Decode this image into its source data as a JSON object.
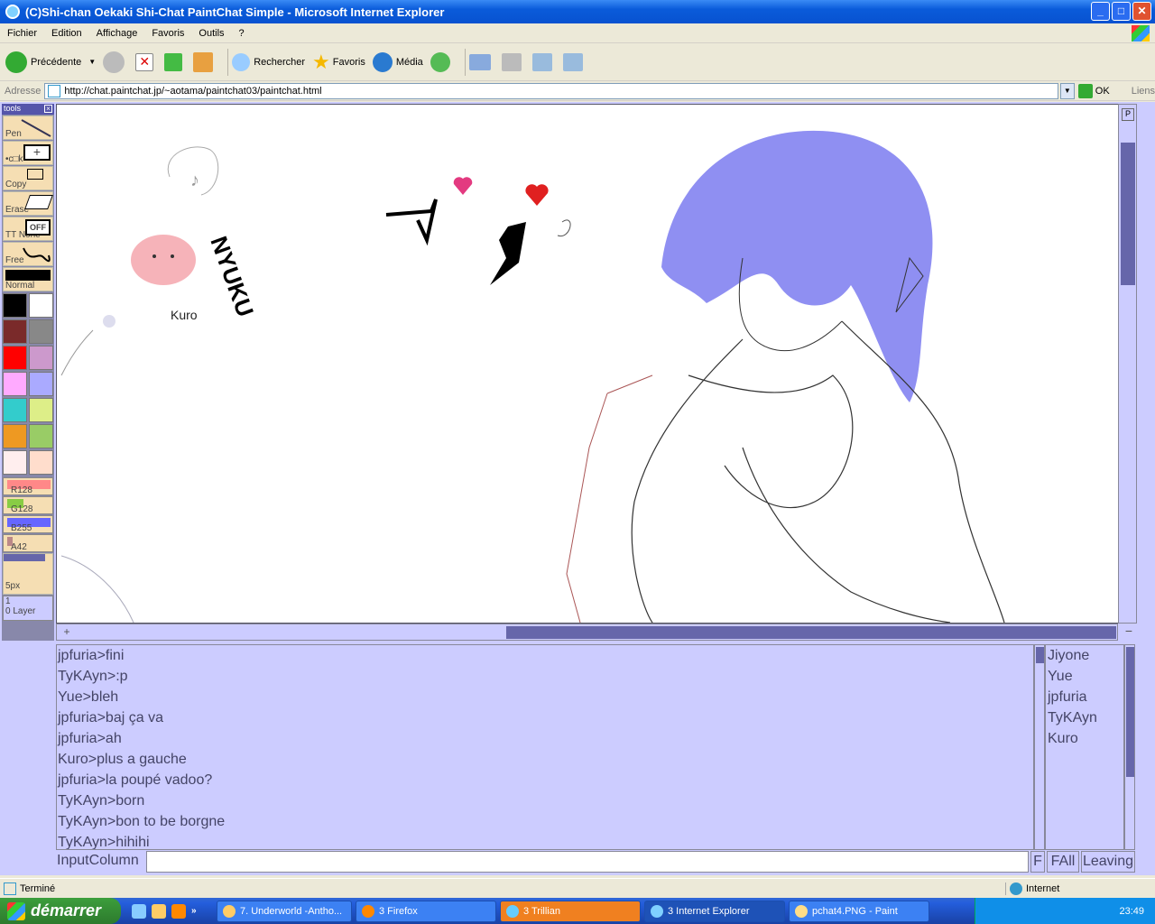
{
  "window": {
    "title": "(C)Shi-chan Oekaki Shi-Chat PaintChat Simple - Microsoft Internet Explorer",
    "controls": [
      "_",
      "□",
      "✕"
    ]
  },
  "menu": [
    "Fichier",
    "Edition",
    "Affichage",
    "Favoris",
    "Outils",
    "?"
  ],
  "toolbar": {
    "back": "Précédente",
    "search": "Rechercher",
    "favorites": "Favoris",
    "media": "Média"
  },
  "address": {
    "label": "Adresse",
    "url": "http://chat.paintchat.jp/~aotama/paintchat03/paintchat.html",
    "go": "OK",
    "links": "Liens"
  },
  "tools": {
    "header": "tools",
    "buttons": [
      "Pen",
      "•c□k",
      "Copy",
      "Erase",
      "TT None",
      "Free",
      "Normal"
    ],
    "colors": [
      "#000000",
      "#FFFFFF",
      "#7A2A2A",
      "#888888",
      "#FF0000",
      "#CC99CC",
      "#FFAAFF",
      "#AAAAFF",
      "#33CCCC",
      "#DDEE88",
      "#EE9922",
      "#99CC66",
      "#FFEEEE",
      "#FFDDCC"
    ],
    "sliders": [
      "R128",
      "G128",
      "B255",
      "A42"
    ],
    "size": "5px",
    "layer_num": "1",
    "layer": "0 Layer"
  },
  "canvas": {
    "doodle_label": "Kuro",
    "doodle_text": "NYUKU"
  },
  "chat": {
    "messages": [
      "jpfuria>fini",
      "TyKAyn>:p",
      "Yue>bleh",
      "jpfuria>baj ça va",
      "jpfuria>ah",
      "Kuro>plus a gauche",
      "jpfuria>la poupé vadoo?",
      "TyKAyn>born",
      "TyKAyn>bon to be borgne",
      "TyKAyn>hihihi"
    ],
    "users": [
      "Jiyone",
      "Yue",
      "jpfuria",
      "TyKAyn",
      "Kuro"
    ],
    "input_label": "InputColumn",
    "btn_f": "F",
    "btn_fall": "FAll",
    "btn_leaving": "Leaving"
  },
  "status": {
    "left": "Terminé",
    "zone": "Internet"
  },
  "taskbar": {
    "start": "démarrer",
    "tasks": [
      "7. Underworld -Antho...",
      "3 Firefox",
      "3 Trillian",
      "3 Internet Explorer",
      "pchat4.PNG - Paint"
    ],
    "clock": "23:49"
  }
}
